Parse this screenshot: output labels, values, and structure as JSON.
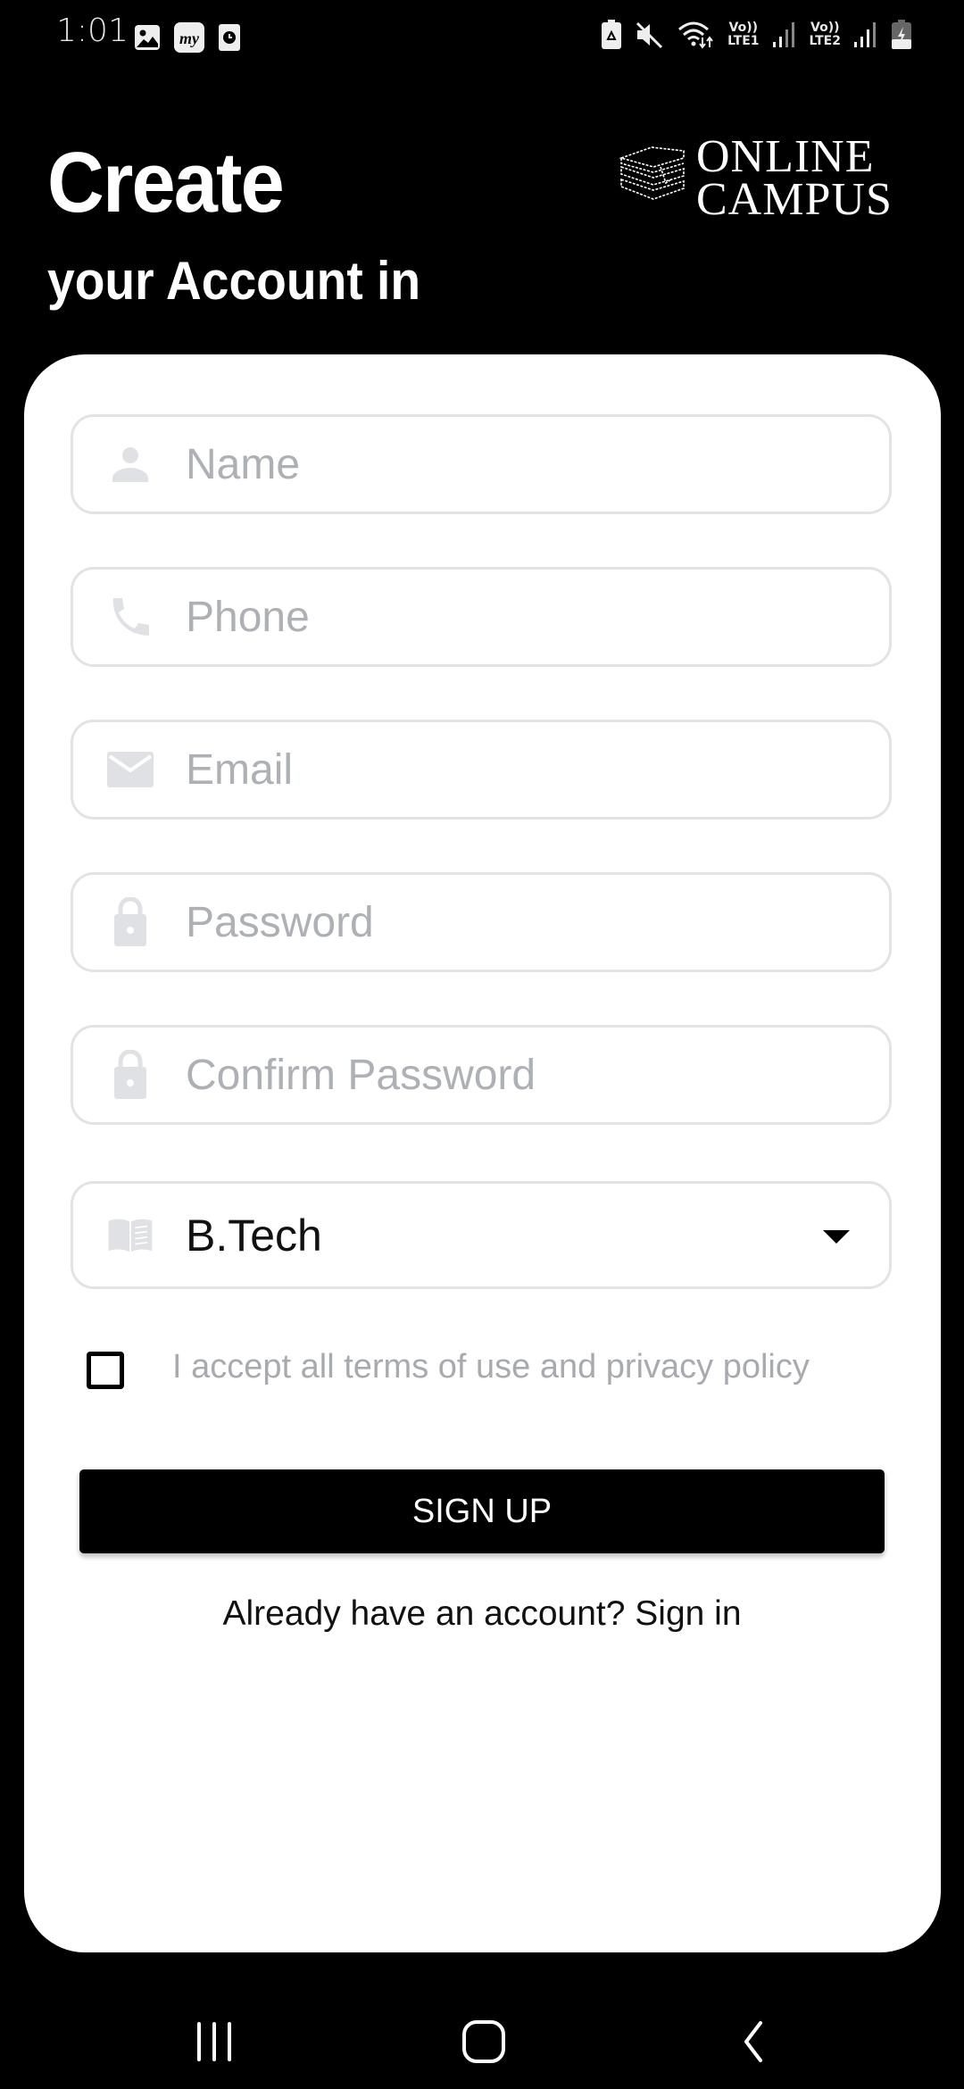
{
  "status_bar": {
    "time": "1:01",
    "left_icons": [
      "gallery-icon",
      "myjio-app-icon",
      "clock-icon"
    ],
    "right_icons": [
      "battery-saver-icon",
      "mute-icon",
      "wifi-icon",
      "volte-lte1-icon",
      "signal-1-icon",
      "volte-lte2-icon",
      "signal-2-icon",
      "battery-charging-icon"
    ],
    "lte1_top": "Vo))",
    "lte1_bottom": "LTE1",
    "lte2_top": "Vo))",
    "lte2_bottom": "LTE2"
  },
  "header": {
    "title": "Create",
    "subtitle": "your Account in",
    "logo_line1": "ONLINE",
    "logo_line2": "CAMPUS"
  },
  "form": {
    "name": {
      "placeholder": "Name",
      "value": "",
      "icon": "person-icon"
    },
    "phone": {
      "placeholder": "Phone",
      "value": "",
      "icon": "phone-icon"
    },
    "email": {
      "placeholder": "Email",
      "value": "",
      "icon": "mail-icon"
    },
    "password": {
      "placeholder": "Password",
      "value": "",
      "icon": "lock-icon"
    },
    "confirm_password": {
      "placeholder": "Confirm Password",
      "value": "",
      "icon": "lock-icon"
    },
    "course": {
      "selected": "B.Tech",
      "icon": "book-icon"
    },
    "terms": {
      "label": "I accept all terms of use and privacy policy",
      "checked": false
    },
    "signup_label": "SIGN UP",
    "signin_prompt": "Already have an account? Sign in"
  },
  "colors": {
    "background": "#000000",
    "card": "#ffffff",
    "field_border": "#e1e3e6",
    "placeholder": "#adb0b4",
    "icon": "#dfe1e5",
    "button": "#000000"
  },
  "nav_bar": {
    "buttons": [
      "recent-apps",
      "home",
      "back"
    ]
  }
}
